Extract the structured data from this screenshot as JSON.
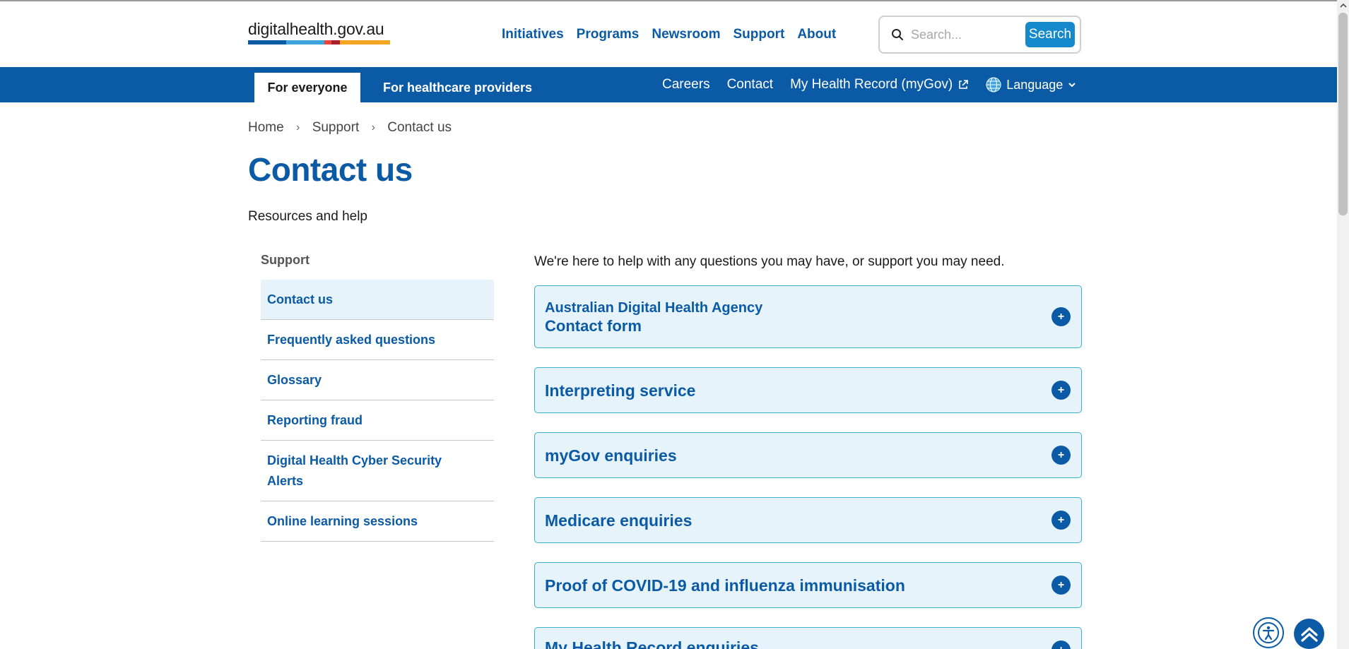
{
  "header": {
    "logo_text": "digitalhealth.gov.au",
    "logo_bar_colors": [
      "#0b5aa6",
      "#3fa3dd",
      "#e8463a",
      "#a8202e",
      "#f4a623"
    ],
    "nav": [
      "Initiatives",
      "Programs",
      "Newsroom",
      "Support",
      "About"
    ],
    "search_placeholder": "Search...",
    "search_button": "Search"
  },
  "bluebar": {
    "tab_everyone": "For everyone",
    "tab_providers": "For healthcare providers",
    "links": [
      "Careers",
      "Contact",
      "My Health Record (myGov)"
    ],
    "language": "Language"
  },
  "breadcrumb": [
    "Home",
    "Support",
    "Contact us"
  ],
  "page": {
    "title": "Contact us",
    "subtitle": "Resources and help",
    "intro": "We're here to help with any questions you may have, or support you may need."
  },
  "sidenav": {
    "title": "Support",
    "items": [
      "Contact us",
      "Frequently asked questions",
      "Glossary",
      "Reporting fraud",
      "Digital Health Cyber Security Alerts",
      "Online learning sessions"
    ]
  },
  "accordion": {
    "first_line1": "Australian Digital Health Agency",
    "first_line2": "Contact form",
    "items": [
      "Interpreting service",
      "myGov enquiries",
      "Medicare enquiries",
      "Proof of COVID-19 and influenza immunisation",
      "My Health Record enquiries"
    ],
    "expand_symbol": "+"
  },
  "colors": {
    "brand_blue": "#0b5aa6",
    "accordion_bg": "#e6f3fb",
    "accordion_border": "#3bb0c9",
    "search_button": "#1589cc"
  }
}
